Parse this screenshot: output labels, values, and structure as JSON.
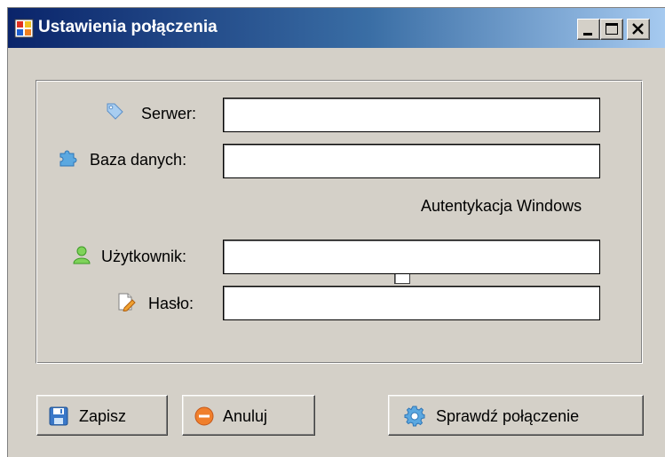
{
  "window": {
    "title": "Ustawienia połączenia",
    "icon": "app-window-icon",
    "controls": [
      "minimize-icon",
      "maximize-icon",
      "close-icon"
    ]
  },
  "form": {
    "server": {
      "label": "Serwer:",
      "icon": "tag-icon",
      "value": ""
    },
    "database": {
      "label": "Baza danych:",
      "icon": "puzzle-icon",
      "value": ""
    },
    "windows_auth": {
      "label": "Autentykacja Windows",
      "checked": false
    },
    "user": {
      "label": "Użytkownik:",
      "icon": "user-icon",
      "value": ""
    },
    "password": {
      "label": "Hasło:",
      "icon": "note-pencil-icon",
      "value": ""
    }
  },
  "buttons": {
    "save": {
      "label": "Zapisz",
      "icon": "floppy-disk-icon"
    },
    "cancel": {
      "label": "Anuluj",
      "icon": "cancel-circle-icon"
    },
    "test": {
      "label": "Sprawdź połączenie",
      "icon": "gear-icon"
    }
  },
  "colors": {
    "title_gradient_start": "#0a246a",
    "title_gradient_end": "#a6caf0",
    "window_bg": "#d4d0c8"
  }
}
